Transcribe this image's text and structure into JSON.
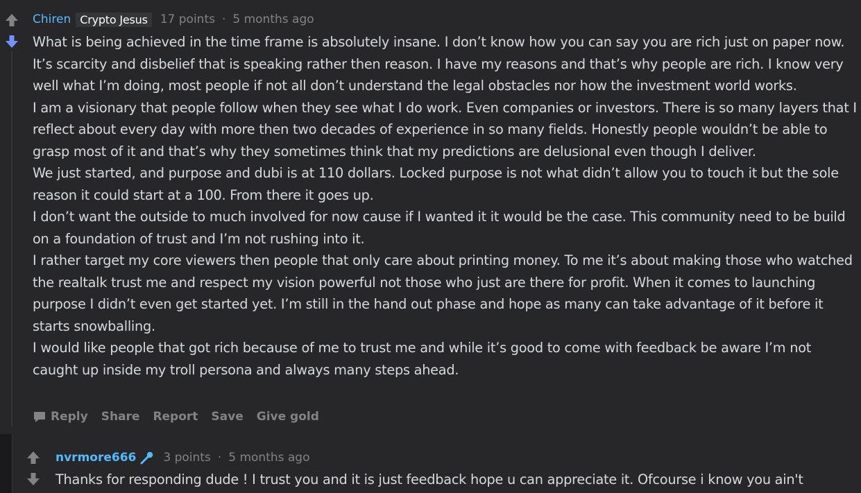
{
  "comment": {
    "author": "Chiren",
    "flair": "Crypto Jesus",
    "points": "17 points",
    "separator": "·",
    "time": "5 months ago",
    "paragraphs": [
      "What is being achieved in the time frame is absolutely insane. I don’t know how you can say you are rich just on paper now. It’s scarcity and disbelief that is speaking rather then reason. I have my reasons and that’s why people are rich. I know very well what I’m doing, most people if not all don’t understand the legal obstacles nor how the investment world works.",
      "I am a visionary that people follow when they see what I do work. Even companies or investors. There is so many layers that I reflect about every day with more then two decades of experience in so many fields. Honestly people wouldn’t be able to grasp most of it and that’s why they sometimes think that my predictions are delusional even though I deliver.",
      "We just started, and purpose and dubi is at 110 dollars. Locked purpose is not what didn’t allow you to touch it but the sole reason it could start at a 100. From there it goes up.",
      "I don’t want the outside to much involved for now cause if I wanted it it would be the case. This community need to be build on a foundation of trust and I’m not rushing into it.",
      "I rather target my core viewers then people that only care about printing money. To me it’s about making those who watched the realtalk trust me and respect my vision powerful not those who just are there for profit. When it comes to launching purpose I didn’t even get started yet. I’m still in the hand out phase and hope as many can take advantage of it before it starts snowballing.",
      "I would like people that got rich because of me to trust me and while it’s good to come with feedback be aware I’m not caught up inside my troll persona and always many steps ahead."
    ],
    "actions": {
      "reply": "Reply",
      "share": "Share",
      "report": "Report",
      "save": "Save",
      "give_gold": "Give gold"
    },
    "vote_state": "downvoted"
  },
  "reply": {
    "author": "nvrmore666",
    "author_badge": "microphone-icon",
    "points": "3 points",
    "separator": "·",
    "time": "5 months ago",
    "text": "Thanks for responding dude ! I trust you and it is just feedback hope u can appreciate it. Ofcourse i know you ain't"
  },
  "colors": {
    "background": "#272729",
    "username": "#4fbcff",
    "downvote_active": "#7193ff",
    "muted": "#818384",
    "text": "#d7dadc"
  }
}
